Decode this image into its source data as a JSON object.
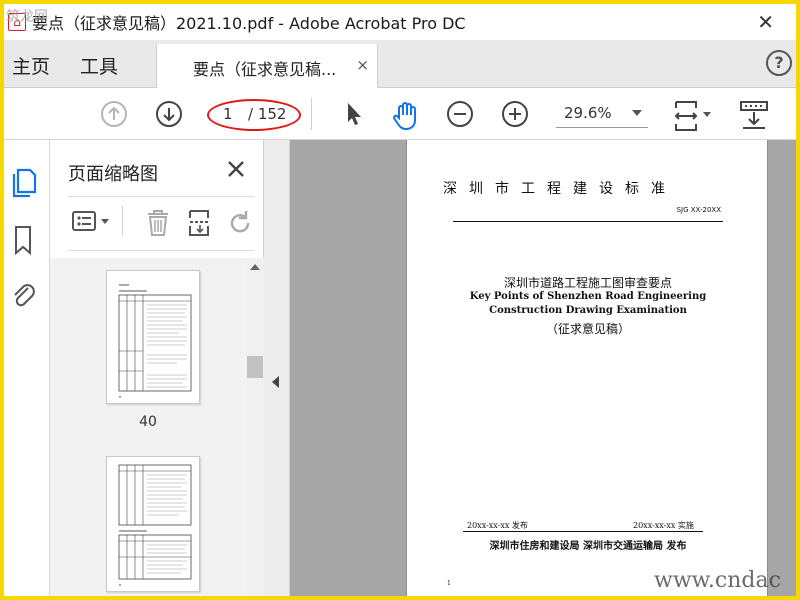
{
  "window": {
    "title": "要点（征求意见稿）2021.10.pdf - Adobe Acrobat Pro DC",
    "close_glyph": "✕",
    "watermark_top": "筑龙网"
  },
  "tabs": {
    "home": "主页",
    "tools": "工具",
    "document": "要点（征求意见稿...",
    "document_close": "×",
    "help": "?"
  },
  "toolbar": {
    "page_current": "1",
    "page_total": "/ 152",
    "zoom": "29.6%",
    "icons": [
      "prev-page-icon",
      "next-page-icon",
      "select-arrow-icon",
      "hand-icon",
      "zoom-out-icon",
      "zoom-in-icon",
      "fit-page-icon",
      "markup-icon"
    ]
  },
  "rail": {
    "icons": [
      "page-thumbnails-icon",
      "bookmarks-icon",
      "attachments-icon"
    ],
    "accent": "#1473e6"
  },
  "thumbnail_pane": {
    "title": "页面缩略图",
    "close": "✕",
    "pages": [
      {
        "number": "40"
      },
      {
        "number": ""
      }
    ]
  },
  "document": {
    "standard_name": "深圳市工程建设标准",
    "standard_code": "SJG XX-20XX",
    "title_cn": "深圳市道路工程施工图审查要点",
    "title_en_line1": "Key Points of Shenzhen Road Engineering",
    "title_en_line2": "Construction Drawing Examination",
    "status": "（征求意见稿）",
    "publish_date": "20xx-xx-xx 发布",
    "effective_date": "20xx-xx-xx 实施",
    "issuers": "深圳市住房和建设局 深圳市交通运输局 发布",
    "footer_mark": "1"
  },
  "watermark_bottom": "www.cndac",
  "colors": {
    "frame": "#f4d800",
    "annotation": "#e01818",
    "accent_blue": "#1473e6"
  }
}
